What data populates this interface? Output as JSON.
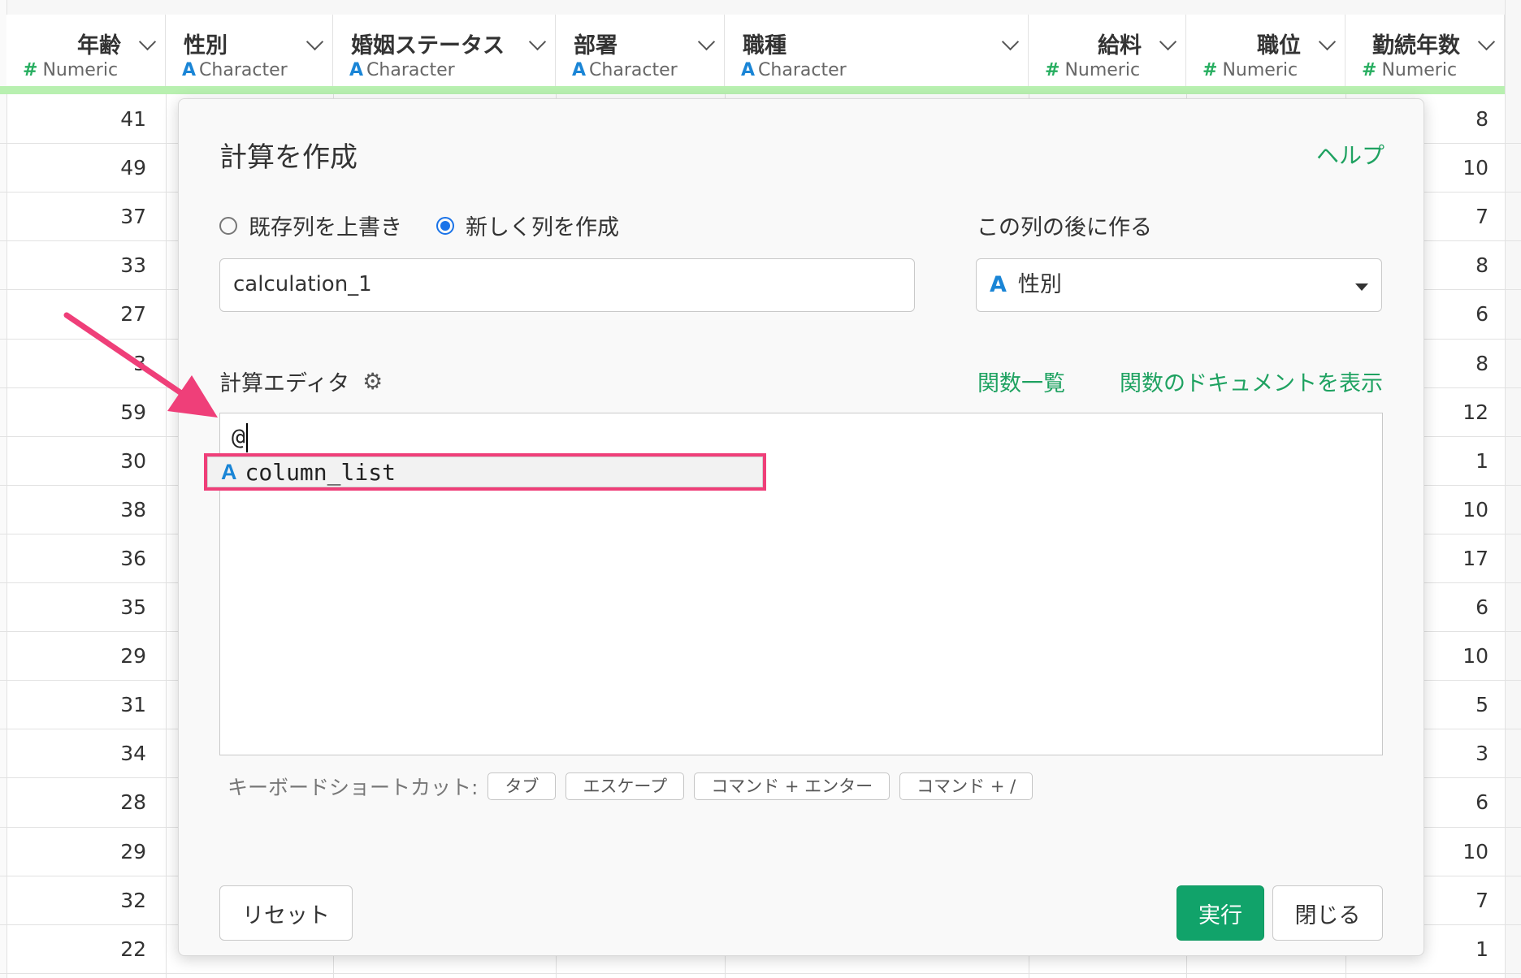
{
  "table": {
    "columns": [
      {
        "name": "年齢",
        "type": "Numeric",
        "type_symbol": "#",
        "align": "right"
      },
      {
        "name": "性別",
        "type": "Character",
        "type_symbol": "A",
        "align": "left"
      },
      {
        "name": "婚姻ステータス",
        "type": "Character",
        "type_symbol": "A",
        "align": "left"
      },
      {
        "name": "部署",
        "type": "Character",
        "type_symbol": "A",
        "align": "left"
      },
      {
        "name": "職種",
        "type": "Character",
        "type_symbol": "A",
        "align": "left"
      },
      {
        "name": "給料",
        "type": "Numeric",
        "type_symbol": "#",
        "align": "right"
      },
      {
        "name": "職位",
        "type": "Numeric",
        "type_symbol": "#",
        "align": "right"
      },
      {
        "name": "勤続年数",
        "type": "Numeric",
        "type_symbol": "#",
        "align": "right"
      }
    ],
    "age_values": [
      "41",
      "49",
      "37",
      "33",
      "27",
      "3",
      "59",
      "30",
      "38",
      "36",
      "35",
      "29",
      "31",
      "34",
      "28",
      "29",
      "32",
      "22"
    ],
    "tenure_values": [
      "8",
      "10",
      "7",
      "8",
      "6",
      "8",
      "12",
      "1",
      "10",
      "17",
      "6",
      "10",
      "5",
      "3",
      "6",
      "10",
      "7",
      "1"
    ]
  },
  "dialog": {
    "title": "計算を作成",
    "help_link": "ヘルプ",
    "radio_overwrite": "既存列を上書き",
    "radio_new": "新しく列を作成",
    "selected_mode": "new",
    "after_label": "この列の後に作る",
    "name_input_value": "calculation_1",
    "after_column_symbol": "A",
    "after_column_value": "性別",
    "editor_label": "計算エディタ",
    "link_function_list": "関数一覧",
    "link_function_docs": "関数のドキュメントを表示",
    "editor_content": "@",
    "suggestion": {
      "symbol": "A",
      "text": "column_list"
    },
    "shortcuts_label": "キーボードショートカット:",
    "shortcuts": [
      "タブ",
      "エスケープ",
      "コマンド + エンター",
      "コマンド + /"
    ],
    "reset_button": "リセット",
    "run_button": "実行",
    "close_button": "閉じる"
  },
  "colors": {
    "accent_green": "#11a36a",
    "link_green": "#1fa261",
    "highlight_pink": "#ef3f79",
    "char_blue": "#1a85d6",
    "numeric_green": "#27ae60"
  }
}
